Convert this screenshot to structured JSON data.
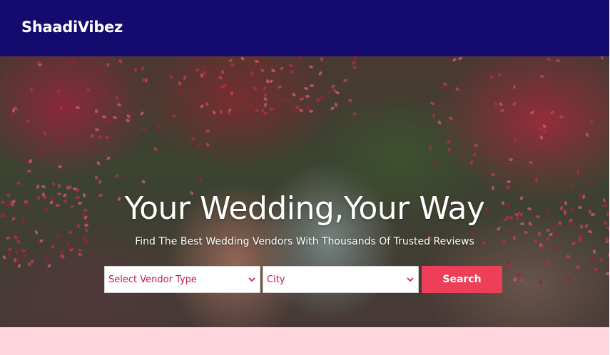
{
  "navbar": {
    "brand": "ShaadiVibez",
    "background_color": "#150a6e"
  },
  "hero": {
    "title": "Your Wedding,Your Way",
    "subtitle": "Find The Best Wedding Vendors With Thousands Of Trusted Reviews",
    "image_description_icon": "wedding-photo"
  },
  "search": {
    "vendor_select": {
      "selected": "Select Vendor Type"
    },
    "city_select": {
      "selected": "City"
    },
    "button_label": "Search",
    "button_color": "#ee3f58",
    "select_text_color": "#c2185b"
  },
  "footer_band": {
    "color": "#ffd6dd"
  }
}
